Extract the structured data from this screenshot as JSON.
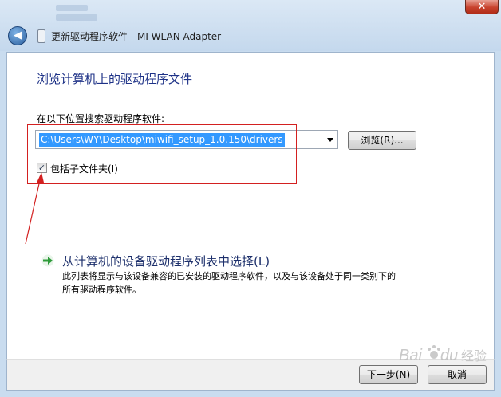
{
  "window": {
    "title": "更新驱动程序软件 - MI WLAN Adapter",
    "close_label": "✕",
    "back_label": "◀"
  },
  "main": {
    "heading": "浏览计算机上的驱动程序文件",
    "search_label": "在以下位置搜索驱动程序软件:",
    "path_value": "C:\\Users\\WY\\Desktop\\miwifi_setup_1.0.150\\drivers",
    "browse_label": "浏览(R)...",
    "include_subfolders_label": "包括子文件夹(I)",
    "include_subfolders_checked": true,
    "check_glyph": "✓"
  },
  "pick_option": {
    "title": "从计算机的设备驱动程序列表中选择(L)",
    "desc_line1": "此列表将显示与该设备兼容的已安装的驱动程序软件，以及与该设备处于同一类别下的",
    "desc_line2": "所有驱动程序软件。"
  },
  "footer": {
    "next_label": "下一步(N)",
    "cancel_label": "取消"
  },
  "watermark": {
    "text": "Bai du 经验"
  },
  "colors": {
    "annotation_red": "#d32020",
    "heading_blue": "#1e3287",
    "selection_blue": "#3399ff",
    "arrow_green": "#2e9b3a"
  }
}
